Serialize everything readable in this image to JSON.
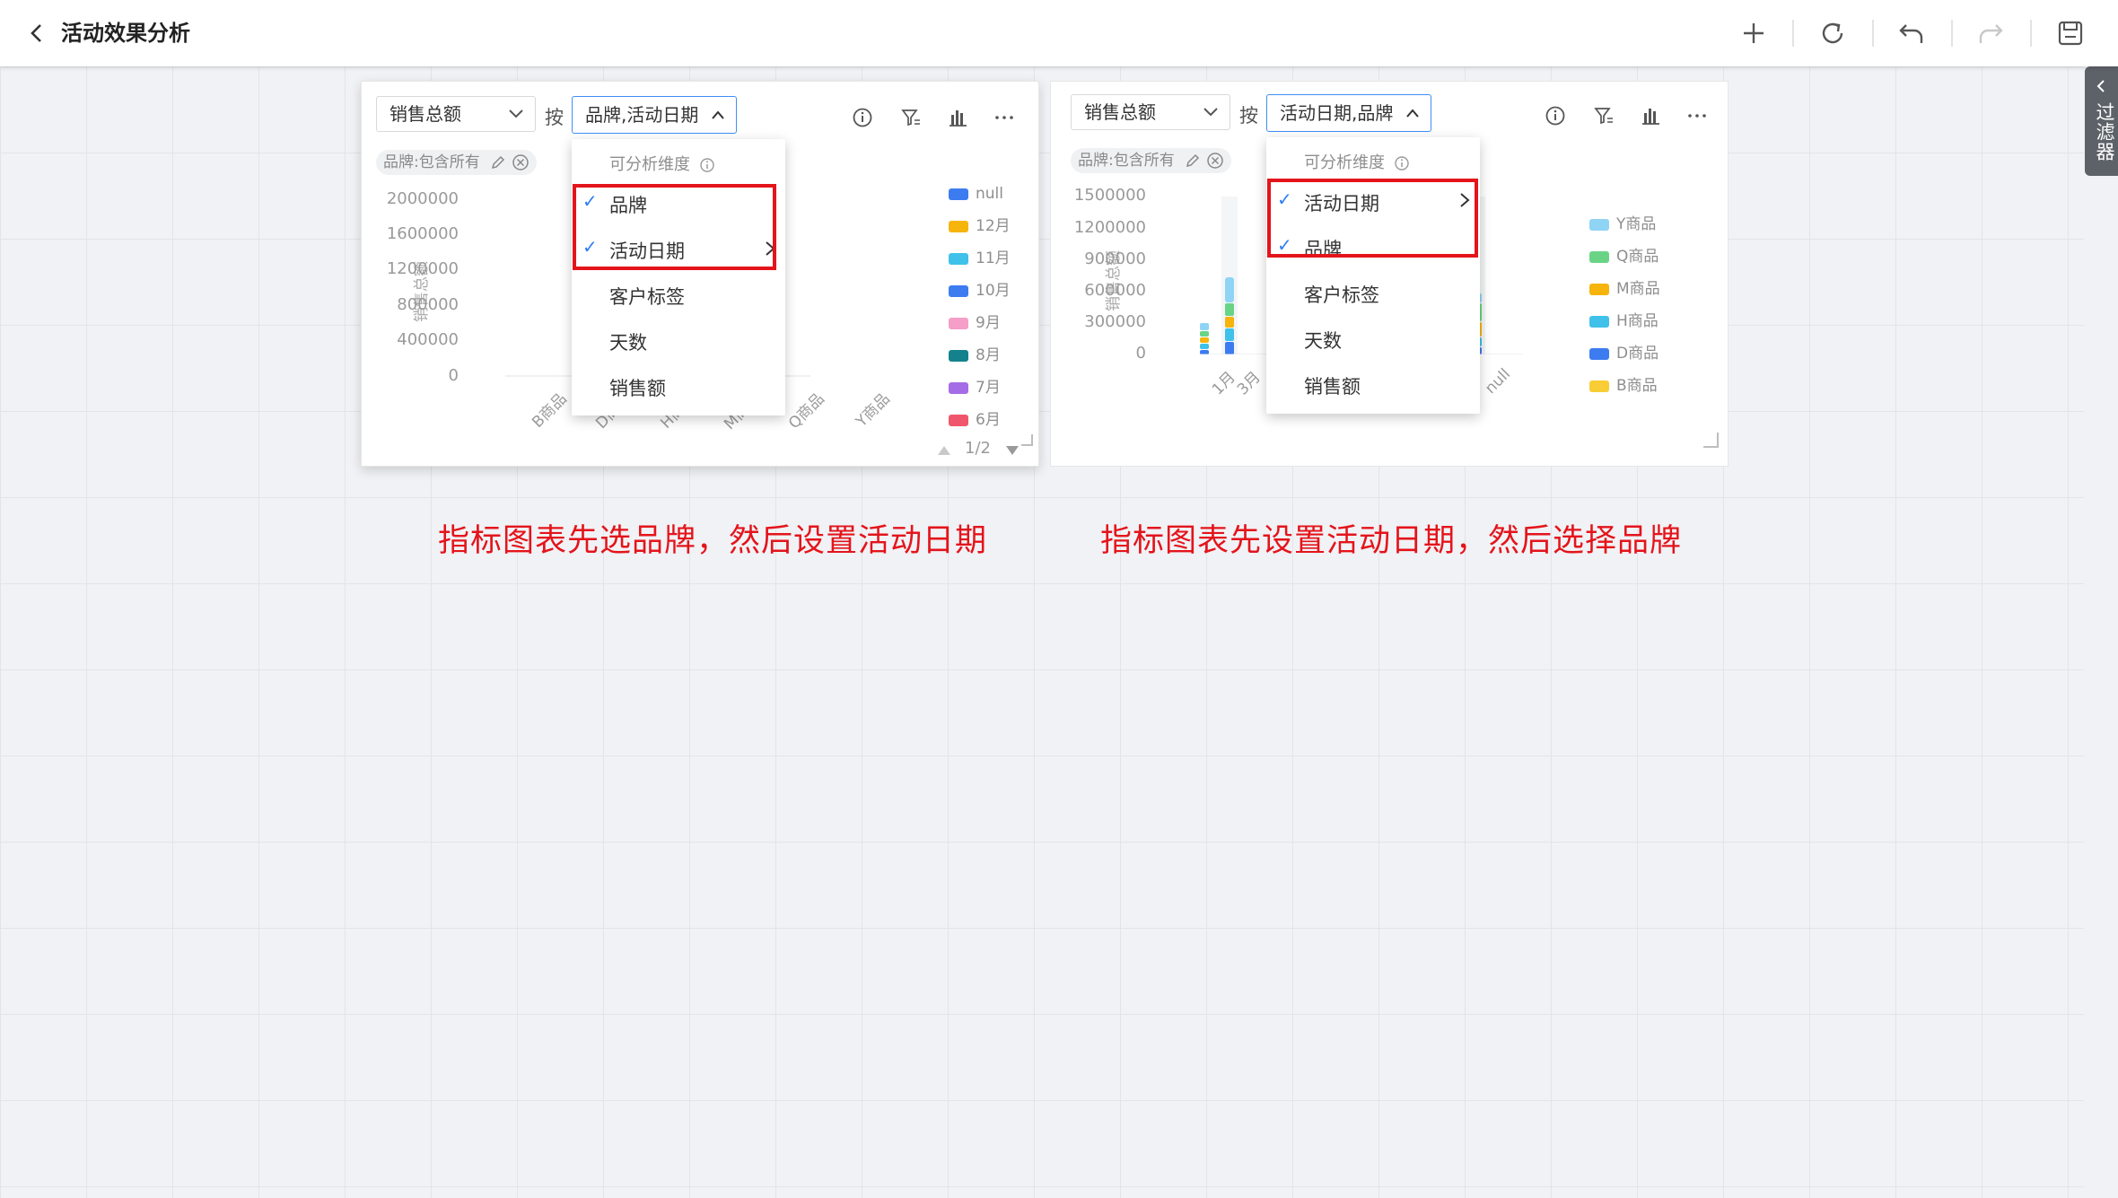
{
  "header": {
    "title": "活动效果分析"
  },
  "filter_panel": {
    "label": "过滤器"
  },
  "left_card": {
    "metric": "销售总额",
    "by": "按",
    "dimensions": "品牌,活动日期",
    "filter_chip": "品牌:包含所有",
    "y_axis_title": "销售总额",
    "y_ticks": [
      "2000000",
      "1600000",
      "1200000",
      "800000",
      "400000",
      "0"
    ],
    "x_ticks": [
      "B商品",
      "D商品",
      "H商品",
      "M商品",
      "Q商品",
      "Y商品"
    ],
    "legend": [
      {
        "label": "null",
        "color": "#3d7cf0"
      },
      {
        "label": "12月",
        "color": "#f6b40c"
      },
      {
        "label": "11月",
        "color": "#3fc1ea"
      },
      {
        "label": "10月",
        "color": "#3d7cf0"
      },
      {
        "label": "9月",
        "color": "#f59ec7"
      },
      {
        "label": "8月",
        "color": "#14828c"
      },
      {
        "label": "7月",
        "color": "#a46de6"
      },
      {
        "label": "6月",
        "color": "#f0566b"
      }
    ],
    "pager": "1/2",
    "dropdown": {
      "header": "可分析维度",
      "items": [
        {
          "label": "品牌",
          "checked": true
        },
        {
          "label": "活动日期",
          "checked": true,
          "submenu": true
        },
        {
          "label": "客户标签",
          "checked": false
        },
        {
          "label": "天数",
          "checked": false
        },
        {
          "label": "销售额",
          "checked": false
        }
      ]
    }
  },
  "right_card": {
    "metric": "销售总额",
    "by": "按",
    "dimensions": "活动日期,品牌",
    "filter_chip": "品牌:包含所有",
    "y_axis_title": "销售总额",
    "y_ticks": [
      "1500000",
      "1200000",
      "900000",
      "600000",
      "300000",
      "0"
    ],
    "x_ticks": [
      "1月",
      "3月",
      "null"
    ],
    "legend": [
      {
        "label": "Y商品",
        "color": "#8fd4f5"
      },
      {
        "label": "Q商品",
        "color": "#6ad486"
      },
      {
        "label": "M商品",
        "color": "#f6b40c"
      },
      {
        "label": "H商品",
        "color": "#3fc1ea"
      },
      {
        "label": "D商品",
        "color": "#3d7cf0"
      },
      {
        "label": "B商品",
        "color": "#f8cd35"
      }
    ],
    "dropdown": {
      "header": "可分析维度",
      "items": [
        {
          "label": "活动日期",
          "checked": true,
          "submenu": true
        },
        {
          "label": "品牌",
          "checked": true
        },
        {
          "label": "客户标签",
          "checked": false
        },
        {
          "label": "天数",
          "checked": false
        },
        {
          "label": "销售额",
          "checked": false
        }
      ]
    }
  },
  "captions": {
    "left": "指标图表先选品牌，然后设置活动日期",
    "right": "指标图表先设置活动日期，然后选择品牌"
  },
  "colors": {
    "accent": "#3e8ef7",
    "highlight_red": "#e4141b"
  }
}
